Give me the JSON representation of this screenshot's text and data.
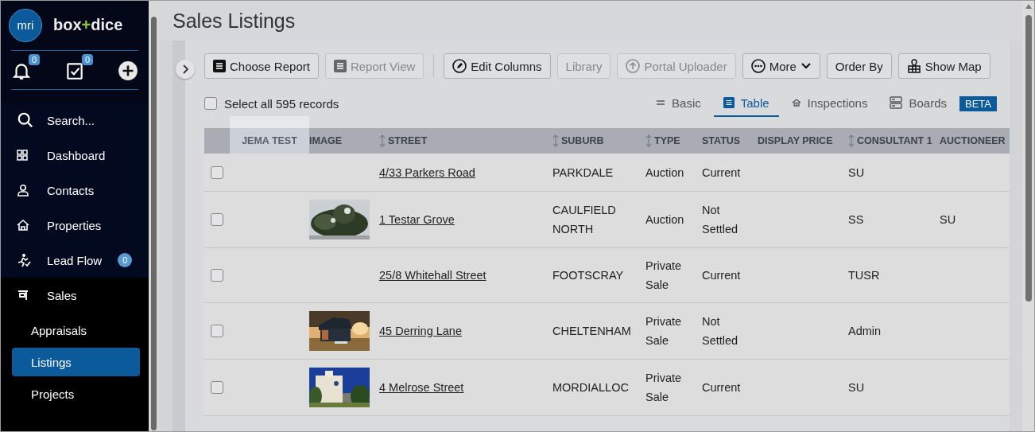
{
  "sidebar": {
    "logo": {
      "mark": "mri",
      "parts": [
        {
          "text": "box",
          "accent": false
        },
        {
          "text": "+",
          "accent": true
        },
        {
          "text": "dice",
          "accent": false
        }
      ]
    },
    "quick_actions": [
      {
        "kind": "bell",
        "count": "0"
      },
      {
        "kind": "tasks",
        "count": "0"
      },
      {
        "kind": "add"
      }
    ],
    "nav": [
      {
        "kind": "search",
        "label": "Search..."
      },
      {
        "kind": "grid",
        "label": "Dashboard"
      },
      {
        "kind": "person",
        "label": "Contacts"
      },
      {
        "kind": "house",
        "label": "Properties"
      },
      {
        "kind": "runner",
        "label": "Lead Flow",
        "badge": "0"
      },
      {
        "kind": "sales",
        "label": "Sales",
        "children": [
          {
            "label": "Appraisals",
            "selected": false
          },
          {
            "label": "Listings",
            "selected": true
          },
          {
            "label": "Projects",
            "selected": false
          }
        ]
      }
    ]
  },
  "page": {
    "title": "Sales Listings"
  },
  "toolbar": [
    {
      "kind": "report",
      "label": "Choose Report",
      "disabled": false
    },
    {
      "kind": "report",
      "label": "Report View",
      "disabled": true
    },
    {
      "kind": "separator"
    },
    {
      "kind": "pencil",
      "label": "Edit Columns",
      "disabled": false
    },
    {
      "kind": "plain",
      "label": "Library",
      "disabled": true
    },
    {
      "kind": "upload",
      "label": "Portal Uploader",
      "disabled": true
    },
    {
      "kind": "more",
      "label": "More",
      "disabled": false
    },
    {
      "kind": "plain",
      "label": "Order By",
      "disabled": false
    },
    {
      "kind": "map",
      "label": "Show Map",
      "disabled": false
    }
  ],
  "select_all": {
    "label": "Select all 595 records",
    "checked": false
  },
  "views": [
    {
      "kind": "basic",
      "label": "Basic",
      "selected": false
    },
    {
      "kind": "table",
      "label": "Table",
      "selected": true
    },
    {
      "kind": "inspections",
      "label": "Inspections",
      "selected": false
    },
    {
      "kind": "boards",
      "label": "Boards",
      "selected": false,
      "badge": "BETA"
    }
  ],
  "table": {
    "columns": [
      {
        "label": "JEMA TEST",
        "sortable": false,
        "highlighted": true
      },
      {
        "label": "IMAGE",
        "sortable": false,
        "highlighted": false
      },
      {
        "label": "STREET",
        "sortable": true,
        "highlighted": false
      },
      {
        "label": "SUBURB",
        "sortable": true,
        "highlighted": false
      },
      {
        "label": "TYPE",
        "sortable": true,
        "highlighted": false
      },
      {
        "label": "STATUS",
        "sortable": false,
        "highlighted": false
      },
      {
        "label": "DISPLAY PRICE",
        "sortable": false,
        "highlighted": false
      },
      {
        "label": "CONSULTANT 1",
        "sortable": true,
        "highlighted": false
      },
      {
        "label": "AUCTIONEER",
        "sortable": false,
        "highlighted": false
      }
    ],
    "rows": [
      {
        "checked": false,
        "street": "4/33 Parkers Road",
        "suburb": "PARKDALE",
        "type": "Auction",
        "status": "Current",
        "consultant": "SU"
      },
      {
        "checked": false,
        "street": "1 Testar Grove",
        "suburb": "CAULFIELD NORTH",
        "type": "Auction",
        "status": "Not Settled",
        "consultant": "SS",
        "auctioneer": "SU"
      },
      {
        "checked": false,
        "street": "25/8 Whitehall Street",
        "suburb": "FOOTSCRAY",
        "type": "Private Sale",
        "status": "Current",
        "consultant": "TUSR"
      },
      {
        "checked": false,
        "street": "45 Derring Lane",
        "suburb": "CHELTENHAM",
        "type": "Private Sale",
        "status": "Not Settled",
        "consultant": "Admin"
      },
      {
        "checked": false,
        "street": "4 Melrose Street",
        "suburb": "MORDIALLOC",
        "type": "Private Sale",
        "status": "Current",
        "consultant": "SU"
      }
    ]
  }
}
